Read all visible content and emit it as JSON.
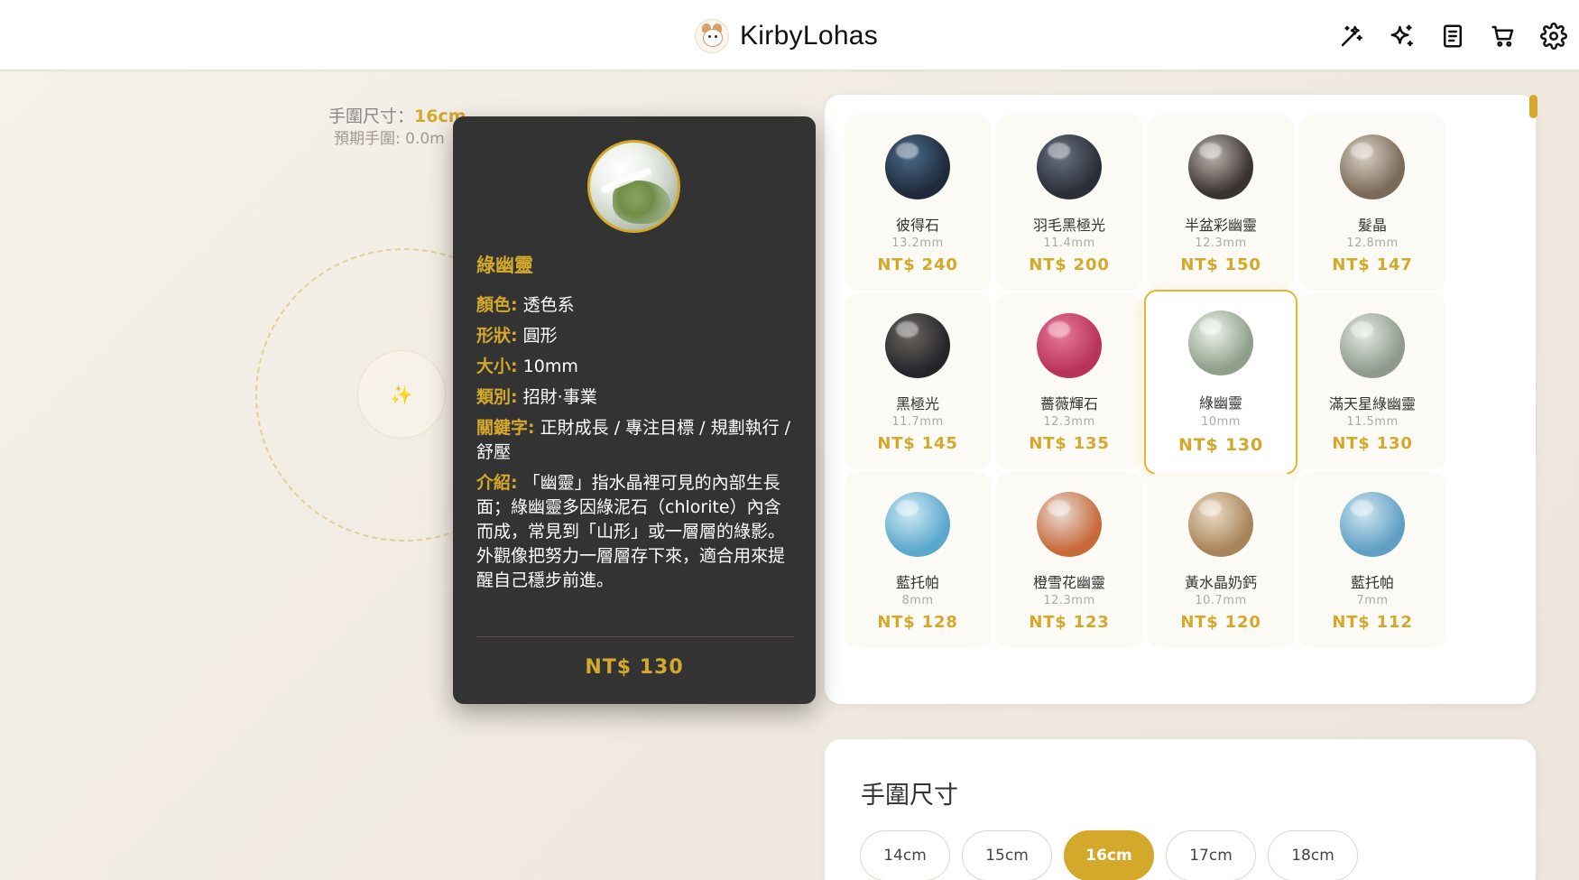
{
  "header": {
    "brand": "KirbyLohas",
    "icons": [
      "magic-wand-icon",
      "sparkles-icon",
      "notebook-icon",
      "cart-icon",
      "gear-icon"
    ]
  },
  "design": {
    "wrist_label": "手圍尺寸：",
    "wrist_value": "16cm",
    "expected_label": "預期手圍: 0.0m",
    "center_symbol": "✨"
  },
  "tooltip": {
    "name": "綠幽靈",
    "rows": [
      {
        "k": "顏色:",
        "v": " 透色系"
      },
      {
        "k": "形狀:",
        "v": " 圓形"
      },
      {
        "k": "大小:",
        "v": " 10mm"
      },
      {
        "k": "類別:",
        "v": " 招財·事業"
      },
      {
        "k": "關鍵字:",
        "v": " 正財成長 / 專注目標 / 規劃執行 / 舒壓"
      },
      {
        "k": "介紹:",
        "v": " 「幽靈」指水晶裡可見的內部生長面；綠幽靈多因綠泥石（chlorite）內含而成，常見到「山形」或一層層的綠影。外觀像把努力一層層存下來，適合用來提醒自己穩步前進。"
      }
    ],
    "price": "NT$ 130"
  },
  "beads": [
    {
      "name": "彼得石",
      "size": "13.2mm",
      "price": "NT$ 240",
      "color": "#1f2a3a",
      "color2": "#4a6a8a"
    },
    {
      "name": "羽毛黑極光",
      "size": "11.4mm",
      "price": "NT$ 200",
      "color": "#2a2e36",
      "color2": "#6a7280"
    },
    {
      "name": "半盆彩幽靈",
      "size": "12.3mm",
      "price": "NT$ 150",
      "color": "#3a3230",
      "color2": "#bdb6b0"
    },
    {
      "name": "髮晶",
      "size": "12.8mm",
      "price": "NT$ 147",
      "color": "#7a6a58",
      "color2": "#d8d0c4"
    },
    {
      "name": "黑極光",
      "size": "11.7mm",
      "price": "NT$ 145",
      "color": "#25252a",
      "color2": "#6b6660"
    },
    {
      "name": "薔薇輝石",
      "size": "12.3mm",
      "price": "NT$ 135",
      "color": "#b8325a",
      "color2": "#e87a98"
    },
    {
      "name": "綠幽靈",
      "size": "10mm",
      "price": "NT$ 130",
      "color": "#8fa08a",
      "color2": "#eef2ec"
    },
    {
      "name": "滿天星綠幽靈",
      "size": "11.5mm",
      "price": "NT$ 130",
      "color": "#8d9a8c",
      "color2": "#e4e9e3"
    },
    {
      "name": "藍托帕",
      "size": "8mm",
      "price": "NT$ 128",
      "color": "#5aa8cc",
      "color2": "#cfeaf4"
    },
    {
      "name": "橙雪花幽靈",
      "size": "12.3mm",
      "price": "NT$ 123",
      "color": "#c8693a",
      "color2": "#e8ddd6"
    },
    {
      "name": "黃水晶奶鈣",
      "size": "10.7mm",
      "price": "NT$ 120",
      "color": "#a8845a",
      "color2": "#eadcc6"
    },
    {
      "name": "藍托帕",
      "size": "7mm",
      "price": "NT$ 112",
      "color": "#5f9fc4",
      "color2": "#d0e6f1"
    }
  ],
  "selected_bead_index": 6,
  "size_section": {
    "title": "手圍尺寸",
    "options": [
      "14cm",
      "15cm",
      "16cm",
      "17cm",
      "18cm"
    ],
    "selected": "16cm"
  },
  "colors": {
    "accent": "#d4a82b",
    "tooltip_bg": "#333333"
  }
}
